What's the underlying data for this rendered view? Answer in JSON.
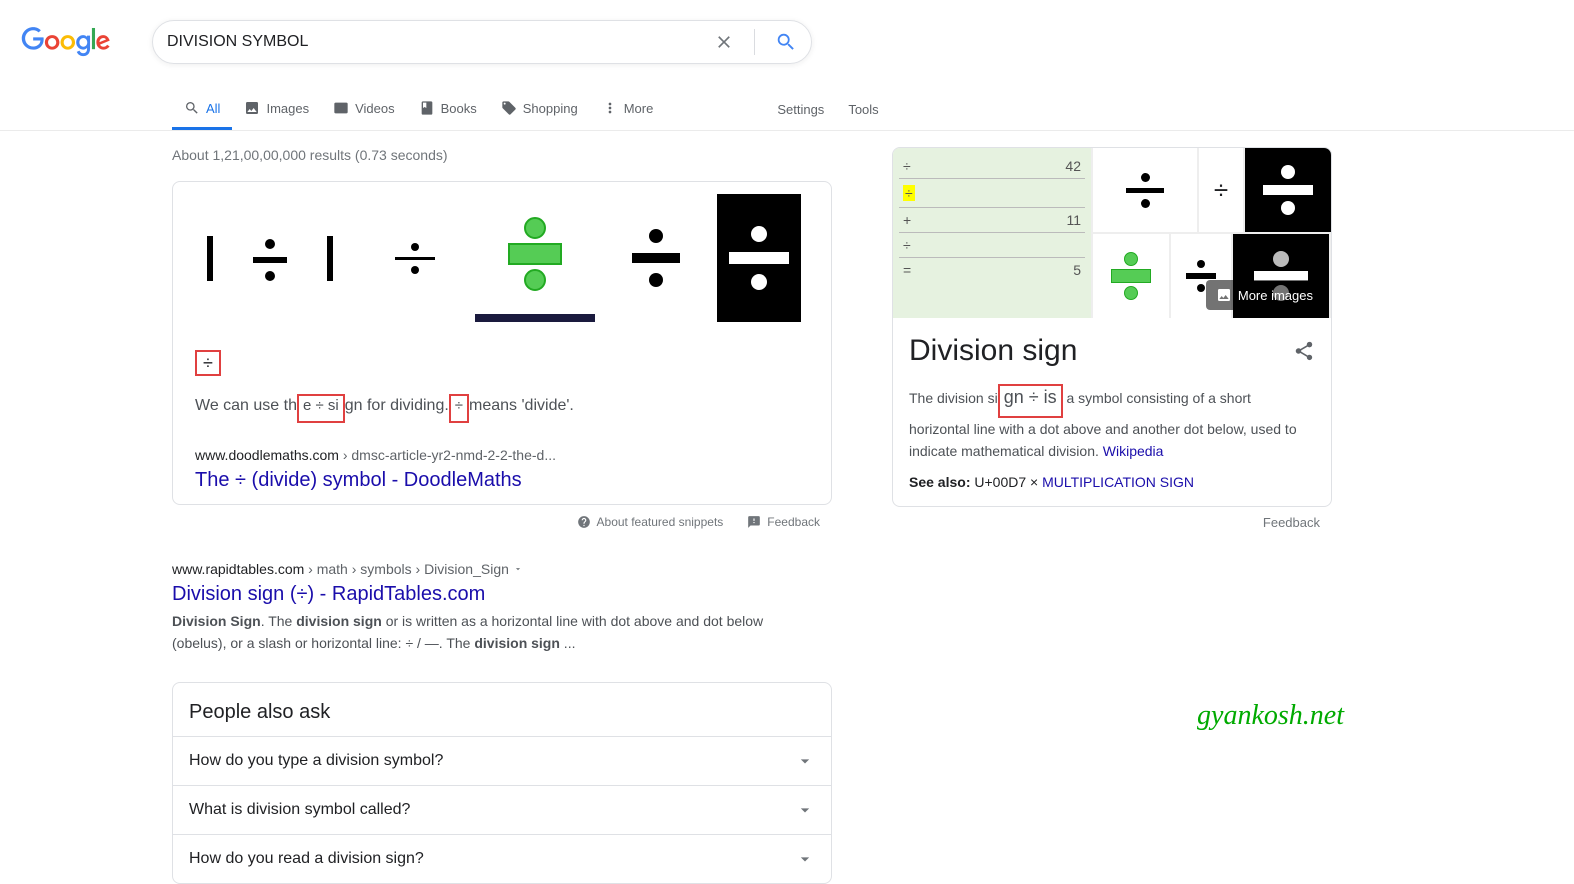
{
  "search": {
    "query": "DIVISION SYMBOL"
  },
  "tabs": {
    "all": "All",
    "images": "Images",
    "videos": "Videos",
    "books": "Books",
    "shopping": "Shopping",
    "more": "More",
    "settings": "Settings",
    "tools": "Tools"
  },
  "stats": "About 1,21,00,00,000 results (0.73 seconds)",
  "featured": {
    "symbol": "÷",
    "text_before": "We can use th",
    "box1": "e ÷ si",
    "text_mid": "gn for dividing.",
    "box2": " ÷ ",
    "text_after": "means 'divide'.",
    "cite_main": "www.doodlemaths.com",
    "cite_path": " › dmsc-article-yr2-nmd-2-2-the-d...",
    "title": "The ÷ (divide) symbol - DoodleMaths",
    "about": "About featured snippets",
    "feedback": "Feedback"
  },
  "organic": {
    "cite_main": "www.rapidtables.com",
    "cite_path": " › math › symbols › Division_Sign",
    "title": "Division sign (÷) - RapidTables.com",
    "desc_b1": "Division Sign",
    "desc_1": ". The ",
    "desc_b2": "division sign",
    "desc_2": " or is written as a horizontal line with dot above and dot below (obelus), or a slash or horizontal line: ÷ / —. The ",
    "desc_b3": "division sign",
    "desc_3": " ..."
  },
  "paa": {
    "title": "People also ask",
    "q1": "How do you type a division symbol?",
    "q2": "What is division symbol called?",
    "q3": "How do you read a division sign?"
  },
  "kp": {
    "more_images": "More images",
    "title": "Division sign",
    "desc_1": "The division si",
    "box": "gn ÷ is",
    "desc_2": " a symbol consisting of a short horizontal line with a dot above and another dot below, used to indicate mathematical division. ",
    "source": "Wikipedia",
    "see_label": "See also:",
    "see_text": " U+00D7 × ",
    "see_link": "MULTIPLICATION SIGN",
    "feedback": "Feedback"
  },
  "watermark": "gyankosh.net"
}
